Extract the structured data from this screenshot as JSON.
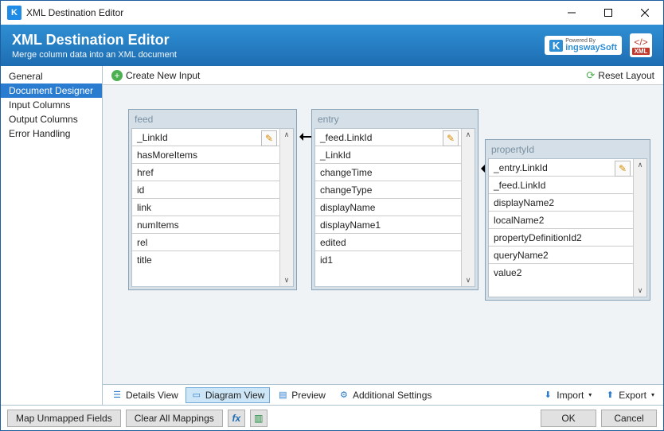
{
  "window": {
    "title": "XML Destination Editor"
  },
  "banner": {
    "title": "XML Destination Editor",
    "subtitle": "Merge column data into an XML document",
    "brand": "ingswaySoft",
    "powered": "Powered By",
    "xml": "XML"
  },
  "sidebar": {
    "items": [
      {
        "label": "General"
      },
      {
        "label": "Document Designer"
      },
      {
        "label": "Input Columns"
      },
      {
        "label": "Output Columns"
      },
      {
        "label": "Error Handling"
      }
    ],
    "selected": 1
  },
  "toolbar": {
    "create": "Create New Input",
    "reset": "Reset Layout"
  },
  "nodes": {
    "feed": {
      "title": "feed",
      "rows": [
        "_LinkId",
        "hasMoreItems",
        "href",
        "id",
        "link",
        "numItems",
        "rel",
        "title"
      ]
    },
    "entry": {
      "title": "entry",
      "rows": [
        "_feed.LinkId",
        "_LinkId",
        "changeTime",
        "changeType",
        "displayName",
        "displayName1",
        "edited",
        "id1"
      ]
    },
    "propertyId": {
      "title": "propertyId",
      "rows": [
        "_entry.LinkId",
        "_feed.LinkId",
        "displayName2",
        "localName2",
        "propertyDefinitionId2",
        "queryName2",
        "value2"
      ]
    }
  },
  "viewbar": {
    "details": "Details View",
    "diagram": "Diagram View",
    "preview": "Preview",
    "additional": "Additional Settings",
    "import": "Import",
    "export": "Export"
  },
  "bottom": {
    "mapUnmapped": "Map Unmapped Fields",
    "clearAll": "Clear All Mappings",
    "ok": "OK",
    "cancel": "Cancel"
  }
}
